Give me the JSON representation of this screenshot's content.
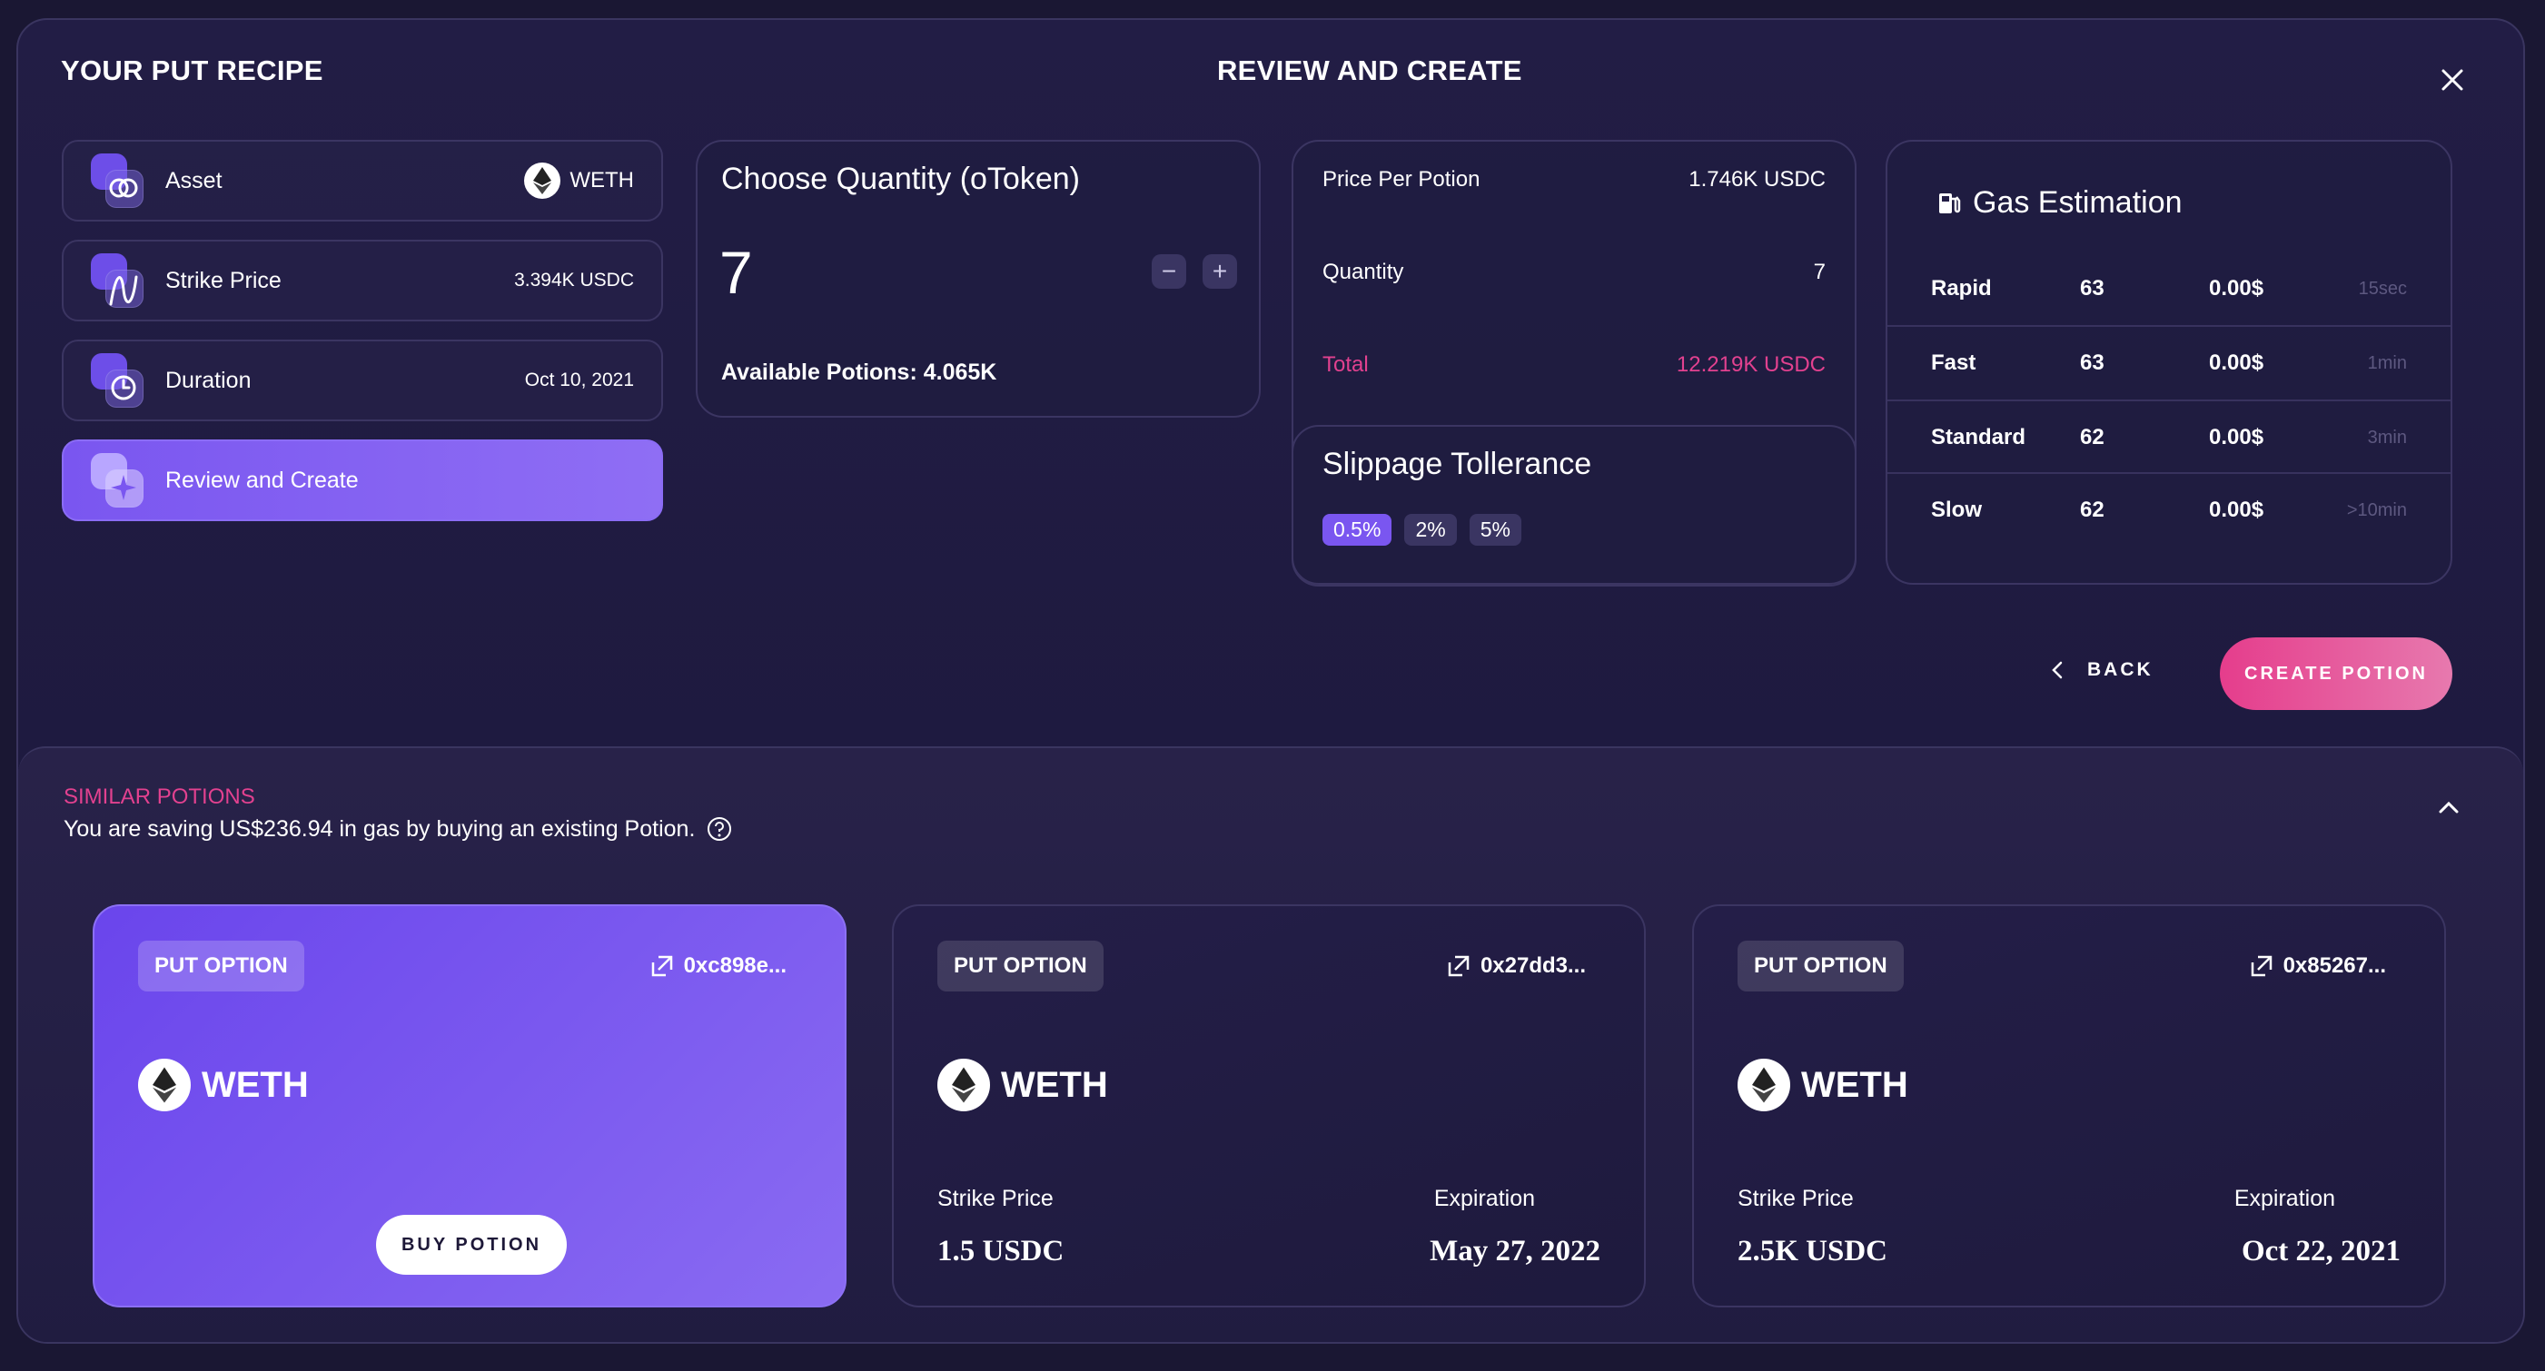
{
  "header": {
    "left_title": "YOUR PUT RECIPE",
    "center_title": "REVIEW AND CREATE"
  },
  "steps": [
    {
      "label": "Asset",
      "value": "WETH",
      "icon": "asset-icon"
    },
    {
      "label": "Strike Price",
      "value": "3.394K USDC",
      "icon": "strike-icon"
    },
    {
      "label": "Duration",
      "value": "Oct 10, 2021",
      "icon": "clock-icon"
    },
    {
      "label": "Review and Create",
      "value": "",
      "icon": "sparkle-icon"
    }
  ],
  "quantity": {
    "title": "Choose Quantity (oToken)",
    "value": "7",
    "available": "Available Potions: 4.065K",
    "minus": "−",
    "plus": "+"
  },
  "summary": {
    "price_label": "Price Per Potion",
    "price_value": "1.746K USDC",
    "quantity_label": "Quantity",
    "quantity_value": "7",
    "total_label": "Total",
    "total_value": "12.219K USDC"
  },
  "slippage": {
    "title": "Slippage Tollerance",
    "options": [
      "0.5%",
      "2%",
      "5%"
    ],
    "selected": "0.5%"
  },
  "gas": {
    "title": "Gas Estimation",
    "rows": [
      {
        "speed": "Rapid",
        "gwei": "63",
        "cost": "0.00$",
        "time": "15sec"
      },
      {
        "speed": "Fast",
        "gwei": "63",
        "cost": "0.00$",
        "time": "1min"
      },
      {
        "speed": "Standard",
        "gwei": "62",
        "cost": "0.00$",
        "time": "3min"
      },
      {
        "speed": "Slow",
        "gwei": "62",
        "cost": "0.00$",
        "time": ">10min"
      }
    ]
  },
  "actions": {
    "back": "BACK",
    "create": "CREATE POTION"
  },
  "similar": {
    "heading": "SIMILAR POTIONS",
    "subtitle": "You are saving US$236.94 in gas by buying an existing Potion.",
    "potions": [
      {
        "type": "PUT OPTION",
        "address": "0xc898e...",
        "asset": "WETH",
        "buy": "BUY POTION"
      },
      {
        "type": "PUT OPTION",
        "address": "0x27dd3...",
        "asset": "WETH",
        "strike_label": "Strike Price",
        "strike": "1.5 USDC",
        "exp_label": "Expiration",
        "expiration": "May 27, 2022"
      },
      {
        "type": "PUT OPTION",
        "address": "0x85267...",
        "asset": "WETH",
        "strike_label": "Strike Price",
        "strike": "2.5K USDC",
        "exp_label": "Expiration",
        "expiration": "Oct 22, 2021"
      }
    ]
  },
  "colors": {
    "accent": "#7a56f0",
    "pink": "#e53d8c",
    "background": "#1a1733"
  }
}
